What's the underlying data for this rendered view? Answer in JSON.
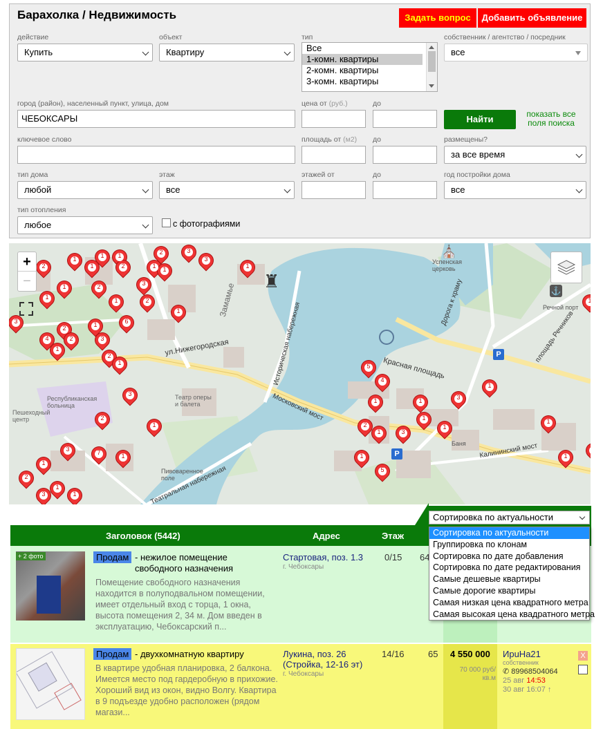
{
  "header": {
    "title": "Барахолка / Недвижимость",
    "ask_button": "Задать вопрос",
    "add_button": "Добавить объявление"
  },
  "filters": {
    "action_label": "действие",
    "action_value": "Купить",
    "object_label": "объект",
    "object_value": "Квартиру",
    "type_label": "тип",
    "type_options": [
      "Все",
      "1-комн. квартиры",
      "2-комн. квартиры",
      "3-комн. квартиры"
    ],
    "type_selected": "1-комн. квартиры",
    "owner_label": "собственник / агентство / посредник",
    "owner_value": "все",
    "city_label": "город (район), населенный пункт, улица, дом",
    "city_value": "ЧЕБОКСАРЫ",
    "price_from_label": "цена от",
    "price_unit": "(руб.)",
    "price_to_label": "до",
    "find_button": "Найти",
    "show_all_link": "показать все поля поиска",
    "keyword_label": "ключевое слово",
    "area_from_label": "площадь от",
    "area_unit": "(м2)",
    "area_to_label": "до",
    "posted_label": "размещены?",
    "posted_value": "за все время",
    "house_type_label": "тип дома",
    "house_type_value": "любой",
    "floor_label": "этаж",
    "floor_value": "все",
    "floors_from_label": "этажей от",
    "floors_to_label": "до",
    "year_label": "год постройки дома",
    "year_value": "все",
    "heating_label": "тип отопления",
    "heating_value": "любое",
    "photos_checkbox": "с фотографиями"
  },
  "map": {
    "zoom_in": "+",
    "zoom_out": "−",
    "labels": [
      "Успенская церковь",
      "Замамье",
      "Речной порт",
      "Красная площадь",
      "ул.Нижегородская",
      "Московский мост",
      "Республиканская больница",
      "Театр оперы и балета",
      "Калининский мост",
      "площадь Речников",
      "Пешеходный центр",
      "Театральная набережная",
      "Дорога к храму",
      "Историческая набережная",
      "Пивоваренное поле",
      "Баня"
    ],
    "pin_numbers": [
      "1",
      "2",
      "3",
      "1",
      "2",
      "1",
      "1",
      "2",
      "1",
      "3",
      "1",
      "1",
      "2",
      "3",
      "1",
      "1",
      "1",
      "2",
      "1",
      "3",
      "2",
      "6",
      "2",
      "1",
      "4",
      "3",
      "1",
      "2",
      "1",
      "3",
      "2",
      "1",
      "3",
      "7",
      "1",
      "1",
      "2",
      "1",
      "1",
      "3",
      "5",
      "4",
      "1",
      "1",
      "3",
      "1",
      "1",
      "2",
      "1",
      "3",
      "1",
      "1",
      "5",
      "1",
      "1",
      "1",
      "3",
      "1",
      "2",
      "1",
      "7",
      "1",
      "1",
      "1",
      "1",
      "2",
      "3",
      "4",
      "1"
    ]
  },
  "sort": {
    "current": "Сортировка по актуальности",
    "options": [
      "Сортировка по актуальности",
      "Группировка по клонам",
      "Сортировка по дате добавления",
      "Сортировка по дате редактирования",
      "Самые дешевые квартиры",
      "Самые дорогие квартиры",
      "Самая низкая цена квадратного метра",
      "Самая высокая цена квадратного метра"
    ]
  },
  "table": {
    "col_title": "Заголовок (5442)",
    "col_address": "Адрес",
    "col_floor": "Этаж",
    "rows": [
      {
        "photo_badge": "+ 2 фото",
        "deal": "Продам",
        "title": "- нежилое помещение свободного назначения",
        "description": "Помещение свободного назначения находится в полуподвальном помещении, имеет отдельный вход с торца, 1 окна, высота помещения 2, 34 м. Дом введен в эксплуатацию, Чебоксарский п...",
        "address": "Стартовая, поз. 1.3",
        "city": "г. Чебоксары",
        "floor": "0/15",
        "area": "64"
      },
      {
        "deal": "Продам",
        "title": "- двухкомнатную квартиру",
        "description": "В квартире удобная планировка, 2 балкона. Имеется место под гардеробную в прихожие. Хороший вид из окон, видно Волгу. Квартира в 9 подъезде удобно расположен (рядом магази...",
        "address": "Лукина, поз. 26 (Стройка, 12-16 эт)",
        "city": "г. Чебоксары",
        "floor": "14/16",
        "area": "65",
        "price": "4 550 000",
        "price_m2": "70 000 руб/ кв.м",
        "seller": "ИрuНа21",
        "seller_type": "собственник",
        "phone": "89968504064",
        "date_added": "25 авг",
        "time_added": "14:53",
        "date_edited": "30 авг 16:07",
        "delete_mark": "X"
      }
    ]
  },
  "colors": {
    "accent_green": "#0a7a0a",
    "red": "#ff0000",
    "row1_bg": "#d7f9d7",
    "row2_bg": "#f8f87a",
    "deal_blue": "#4a86e8"
  }
}
